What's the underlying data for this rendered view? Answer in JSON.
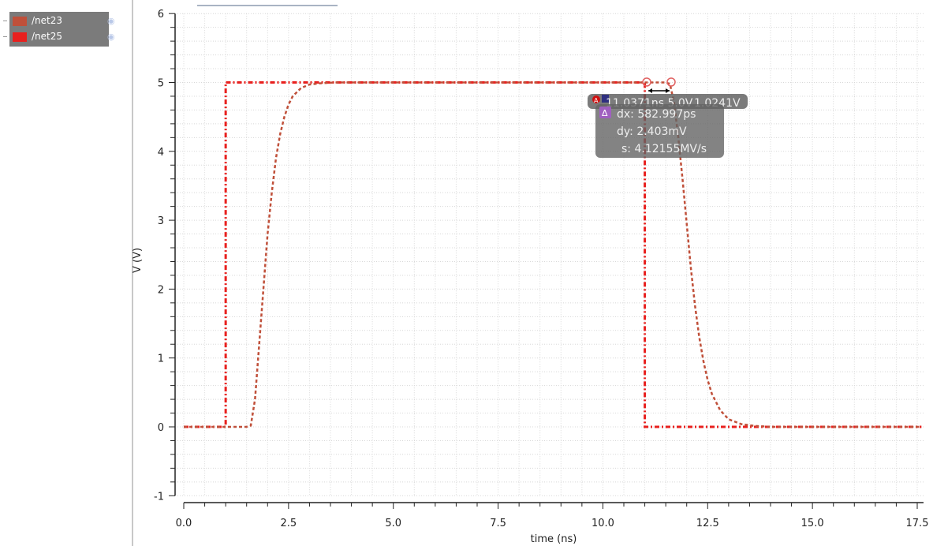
{
  "legend": [
    {
      "name": "/net23",
      "color": "#c0503a",
      "icon": "eye-icon"
    },
    {
      "name": "/net25",
      "color": "#e8201e",
      "icon": "eye-icon"
    }
  ],
  "marker": {
    "a_label": "11.0371ns 5.0V",
    "b_label": "1.0241V",
    "dx": "dx: 582.997ps",
    "dy": "dy: 2.403mV",
    "s": "s: 4.12155MV/s",
    "delta_icon": "delta-icon"
  },
  "chart_data": {
    "type": "line",
    "xlabel": "time (ns)",
    "ylabel": "V (V)",
    "xlim": [
      0,
      17.5
    ],
    "ylim": [
      -1,
      6
    ],
    "xticks": [
      "0.0",
      "2.5",
      "5.0",
      "7.5",
      "10.0",
      "12.5",
      "15.0",
      "17.5"
    ],
    "xtick_values": [
      0,
      2.5,
      5,
      7.5,
      10,
      12.5,
      15,
      17.5
    ],
    "yticks": [
      "-1",
      "0",
      "1",
      "2",
      "3",
      "4",
      "5",
      "6"
    ],
    "ytick_values": [
      -1,
      0,
      1,
      2,
      3,
      4,
      5,
      6
    ],
    "grid": true,
    "legend_placement": "top-left",
    "series": [
      {
        "name": "/net25",
        "color": "#e8201e",
        "x": [
          0,
          1.0,
          1.0,
          11.0,
          11.0,
          17.6
        ],
        "y": [
          0,
          0,
          5,
          5,
          0,
          0
        ]
      },
      {
        "name": "/net23",
        "color": "#c0503a",
        "x": [
          0,
          1.5,
          1.6,
          1.7,
          1.8,
          1.9,
          2.0,
          2.1,
          2.2,
          2.3,
          2.4,
          2.5,
          2.6,
          2.8,
          3.0,
          3.3,
          3.6,
          11.5,
          11.6,
          11.7,
          11.8,
          11.9,
          12.0,
          12.1,
          12.2,
          12.3,
          12.4,
          12.5,
          12.6,
          12.8,
          13.0,
          13.3,
          13.6,
          14.0,
          17.6
        ],
        "y": [
          0,
          0,
          0.02,
          0.4,
          1.2,
          2.0,
          2.8,
          3.4,
          3.9,
          4.25,
          4.5,
          4.68,
          4.8,
          4.92,
          4.97,
          4.99,
          5,
          5,
          4.98,
          4.7,
          4.2,
          3.6,
          2.95,
          2.3,
          1.75,
          1.3,
          0.95,
          0.68,
          0.48,
          0.24,
          0.11,
          0.04,
          0.015,
          0,
          0
        ]
      }
    ]
  }
}
